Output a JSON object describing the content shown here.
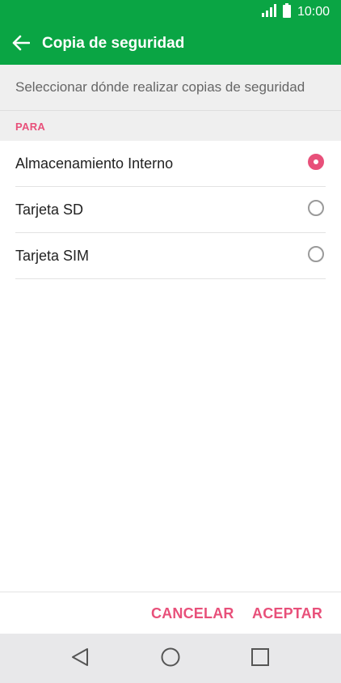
{
  "status_bar": {
    "time": "10:00",
    "signal_icon": "signal-icon",
    "battery_icon": "battery-icon"
  },
  "app_bar": {
    "title": "Copia de seguridad",
    "back_icon": "arrow-back-icon"
  },
  "subheader": {
    "text": "Seleccionar dónde realizar copias de seguridad"
  },
  "section": {
    "label": "PARA"
  },
  "options": [
    {
      "label": "Almacenamiento Interno",
      "selected": true
    },
    {
      "label": "Tarjeta SD",
      "selected": false
    },
    {
      "label": "Tarjeta SIM",
      "selected": false
    }
  ],
  "actions": {
    "cancel": "CANCELAR",
    "accept": "ACEPTAR"
  },
  "nav": {
    "back_icon": "nav-back-icon",
    "home_icon": "nav-home-icon",
    "recents_icon": "nav-recents-icon"
  },
  "colors": {
    "primary": "#0aa544",
    "accent": "#e8507a",
    "subheader_bg": "#efefef",
    "navbar_bg": "#e8e8ea"
  }
}
